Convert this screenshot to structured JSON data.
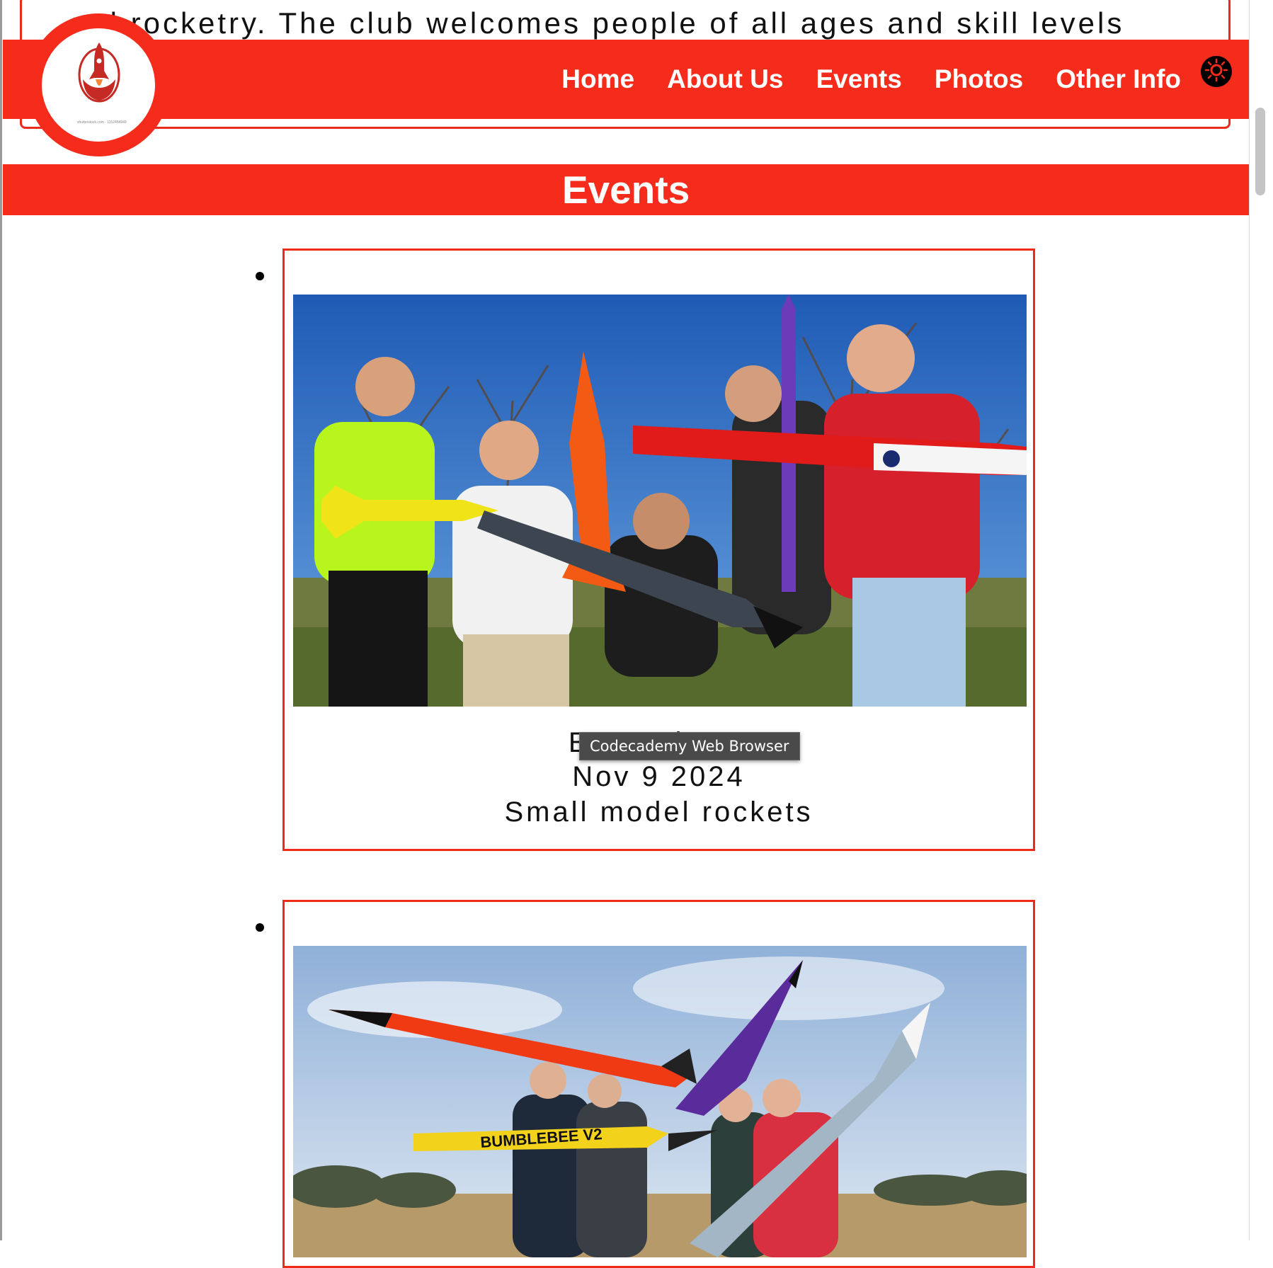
{
  "intro": {
    "text": "m  l rocketry. The club welcomes people of all ages and skill levels"
  },
  "header": {
    "logo_alt": "rocket club logo",
    "logo_caption": "shutterstock.com · 1152454949",
    "nav": [
      {
        "label": "Home"
      },
      {
        "label": "About Us"
      },
      {
        "label": "Events"
      },
      {
        "label": "Photos"
      },
      {
        "label": "Other Info"
      }
    ],
    "theme_icon": "sun-toggle-icon"
  },
  "events_section": {
    "title": "Events",
    "events": [
      {
        "image_desc": "group-with-model-rockets",
        "name": "Event day 1",
        "date": "Nov 9 2024",
        "description": "Small model rockets"
      },
      {
        "image_desc": "group-with-large-rockets",
        "rocket_label": "BUMBLEBEE V2"
      }
    ]
  },
  "tooltip": {
    "text": "Codecademy Web Browser"
  },
  "colors": {
    "accent": "#f52c1c",
    "border": "#ee2a1c"
  }
}
